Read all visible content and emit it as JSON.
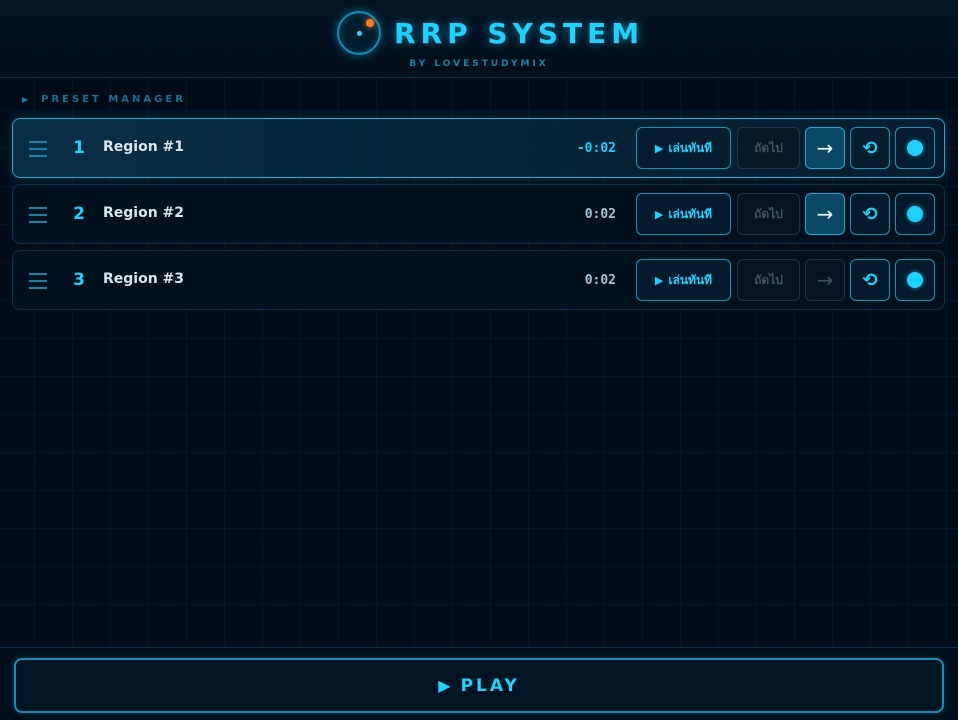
{
  "header": {
    "title": "RRP SYSTEM",
    "subtitle": "BY LOVESTUDYMIX"
  },
  "section": {
    "label": "PRESET MANAGER"
  },
  "regions": [
    {
      "number": "1",
      "name": "Region #1",
      "time": "-0:02",
      "play_label": "เล่นทันที",
      "next_label": "ถัดไป",
      "arrow": "→",
      "reset": "⟲",
      "active": true,
      "arrow_enabled": true
    },
    {
      "number": "2",
      "name": "Region #2",
      "time": "0:02",
      "play_label": "เล่นทันที",
      "next_label": "ถัดไป",
      "arrow": "→",
      "reset": "⟲",
      "active": false,
      "arrow_enabled": true
    },
    {
      "number": "3",
      "name": "Region #3",
      "time": "0:02",
      "play_label": "เล่นทันที",
      "next_label": "ถัดไป",
      "arrow": "→",
      "reset": "⟲",
      "active": false,
      "arrow_enabled": false
    }
  ],
  "footer": {
    "play_label": "PLAY"
  },
  "colors": {
    "accent": "#1ed2ff",
    "background": "#020c17",
    "blip": "#ff7a1a"
  }
}
